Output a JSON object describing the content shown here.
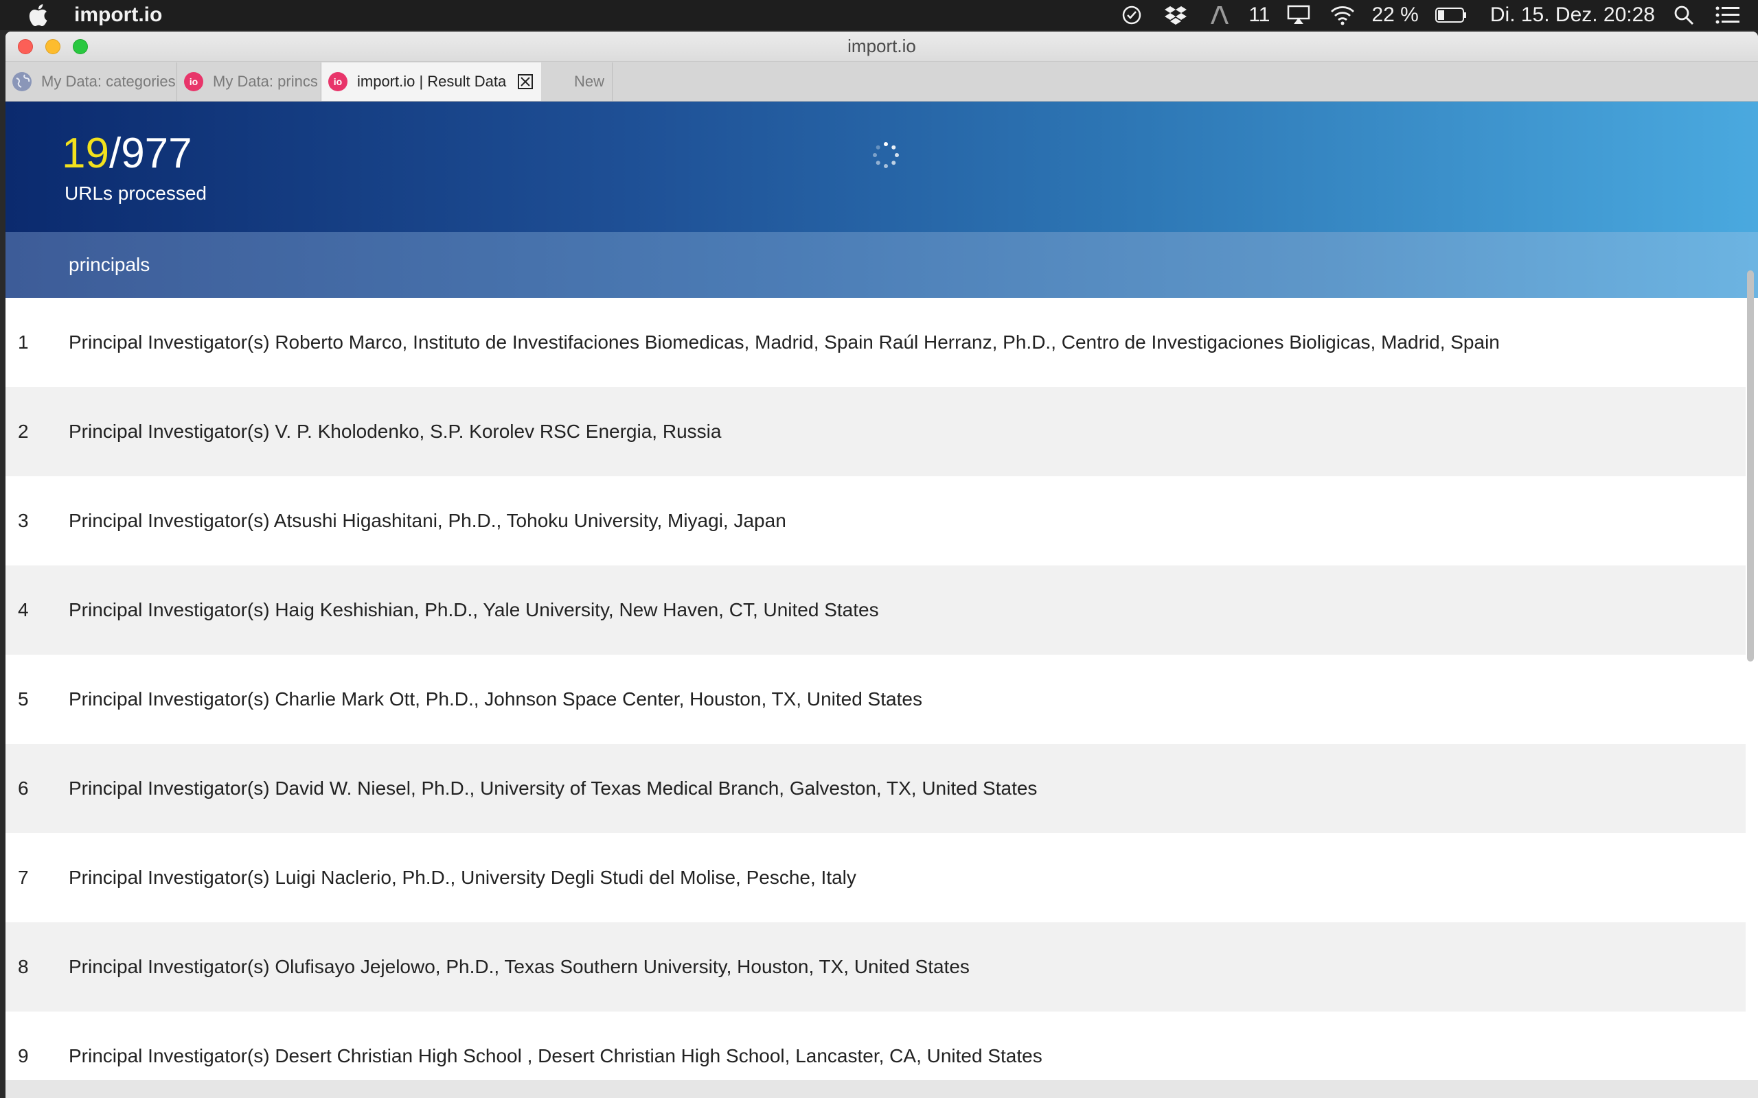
{
  "menubar": {
    "app_name": "import.io",
    "notification_count": "11",
    "battery": "22 %",
    "clock": "Di. 15. Dez.  20:28"
  },
  "window": {
    "title": "import.io"
  },
  "tabs": [
    {
      "label": "My Data: categories",
      "icon": "globe-icon",
      "active": false
    },
    {
      "label": "My Data: princs",
      "icon": "io-icon",
      "active": false
    },
    {
      "label": "import.io | Result Data",
      "icon": "io-icon",
      "active": true
    },
    {
      "label": "New",
      "icon": "",
      "active": false
    }
  ],
  "tab_icon_text": "io",
  "header": {
    "processed": "19",
    "total": "/977",
    "label": "URLs processed"
  },
  "table": {
    "column": "principals",
    "rows": [
      {
        "index": "1",
        "value": "Principal Investigator(s) Roberto Marco, Instituto de Investifaciones Biomedicas, Madrid, Spain Raúl Herranz, Ph.D., Centro de Investigaciones Bioligicas, Madrid, Spain"
      },
      {
        "index": "2",
        "value": "Principal Investigator(s) V. P. Kholodenko, S.P. Korolev RSC Energia, Russia"
      },
      {
        "index": "3",
        "value": "Principal Investigator(s) Atsushi Higashitani, Ph.D., Tohoku University, Miyagi, Japan"
      },
      {
        "index": "4",
        "value": "Principal Investigator(s) Haig Keshishian, Ph.D., Yale University, New Haven, CT, United States"
      },
      {
        "index": "5",
        "value": "Principal Investigator(s) Charlie Mark Ott, Ph.D., Johnson Space Center, Houston, TX, United States"
      },
      {
        "index": "6",
        "value": "Principal Investigator(s) David W. Niesel, Ph.D., University of Texas Medical Branch, Galveston, TX, United States"
      },
      {
        "index": "7",
        "value": "Principal Investigator(s) Luigi Naclerio, Ph.D., University Degli Studi del Molise, Pesche, Italy"
      },
      {
        "index": "8",
        "value": "Principal Investigator(s) Olufisayo Jejelowo, Ph.D., Texas Southern University, Houston, TX, United States"
      },
      {
        "index": "9",
        "value": "Principal Investigator(s) Desert Christian High School , Desert Christian High School, Lancaster, CA, United States"
      }
    ]
  },
  "colors": {
    "accent_yellow": "#f2e11d",
    "header_start": "#0b2a6e",
    "header_end": "#4aa9df",
    "io_pink": "#e8356a"
  }
}
